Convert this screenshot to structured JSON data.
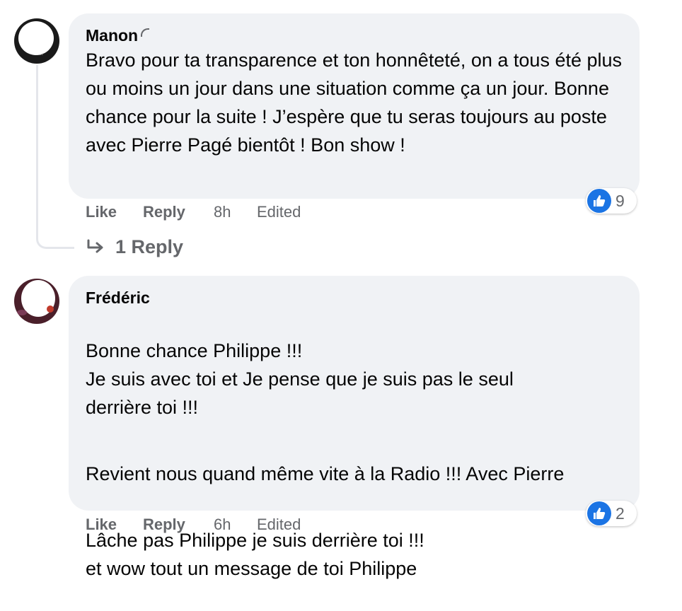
{
  "comments": [
    {
      "author": "Manon",
      "paragraphs": [
        "Bravo pour ta transparence et ton honnêteté, on a tous été plus ou moins un jour dans une situation comme ça un jour. Bonne chance pour la suite ! J’espère que tu seras toujours au poste avec Pierre Pagé bientôt ! Bon show !"
      ],
      "reaction_count": "9",
      "actions": {
        "like": "Like",
        "reply": "Reply",
        "time": "8h",
        "edited": "Edited"
      },
      "replies_link": "1 Reply"
    },
    {
      "author": "Frédéric",
      "paragraphs": [
        "Bonne chance Philippe !!!\nJe suis avec toi et Je pense que je suis pas le seul derrière toi !!!",
        "Revient nous quand même vite à la Radio !!! Avec Pierre",
        "Lâche pas Philippe je suis derrière toi !!!\net wow tout un message de toi Philippe"
      ],
      "reaction_count": "2",
      "actions": {
        "like": "Like",
        "reply": "Reply",
        "time": "6h",
        "edited": "Edited"
      }
    }
  ],
  "icons": {
    "reaction": "thumbs-up-icon",
    "reply_arrow": "reply-arrow-icon",
    "like_color": "#1b74e4"
  }
}
